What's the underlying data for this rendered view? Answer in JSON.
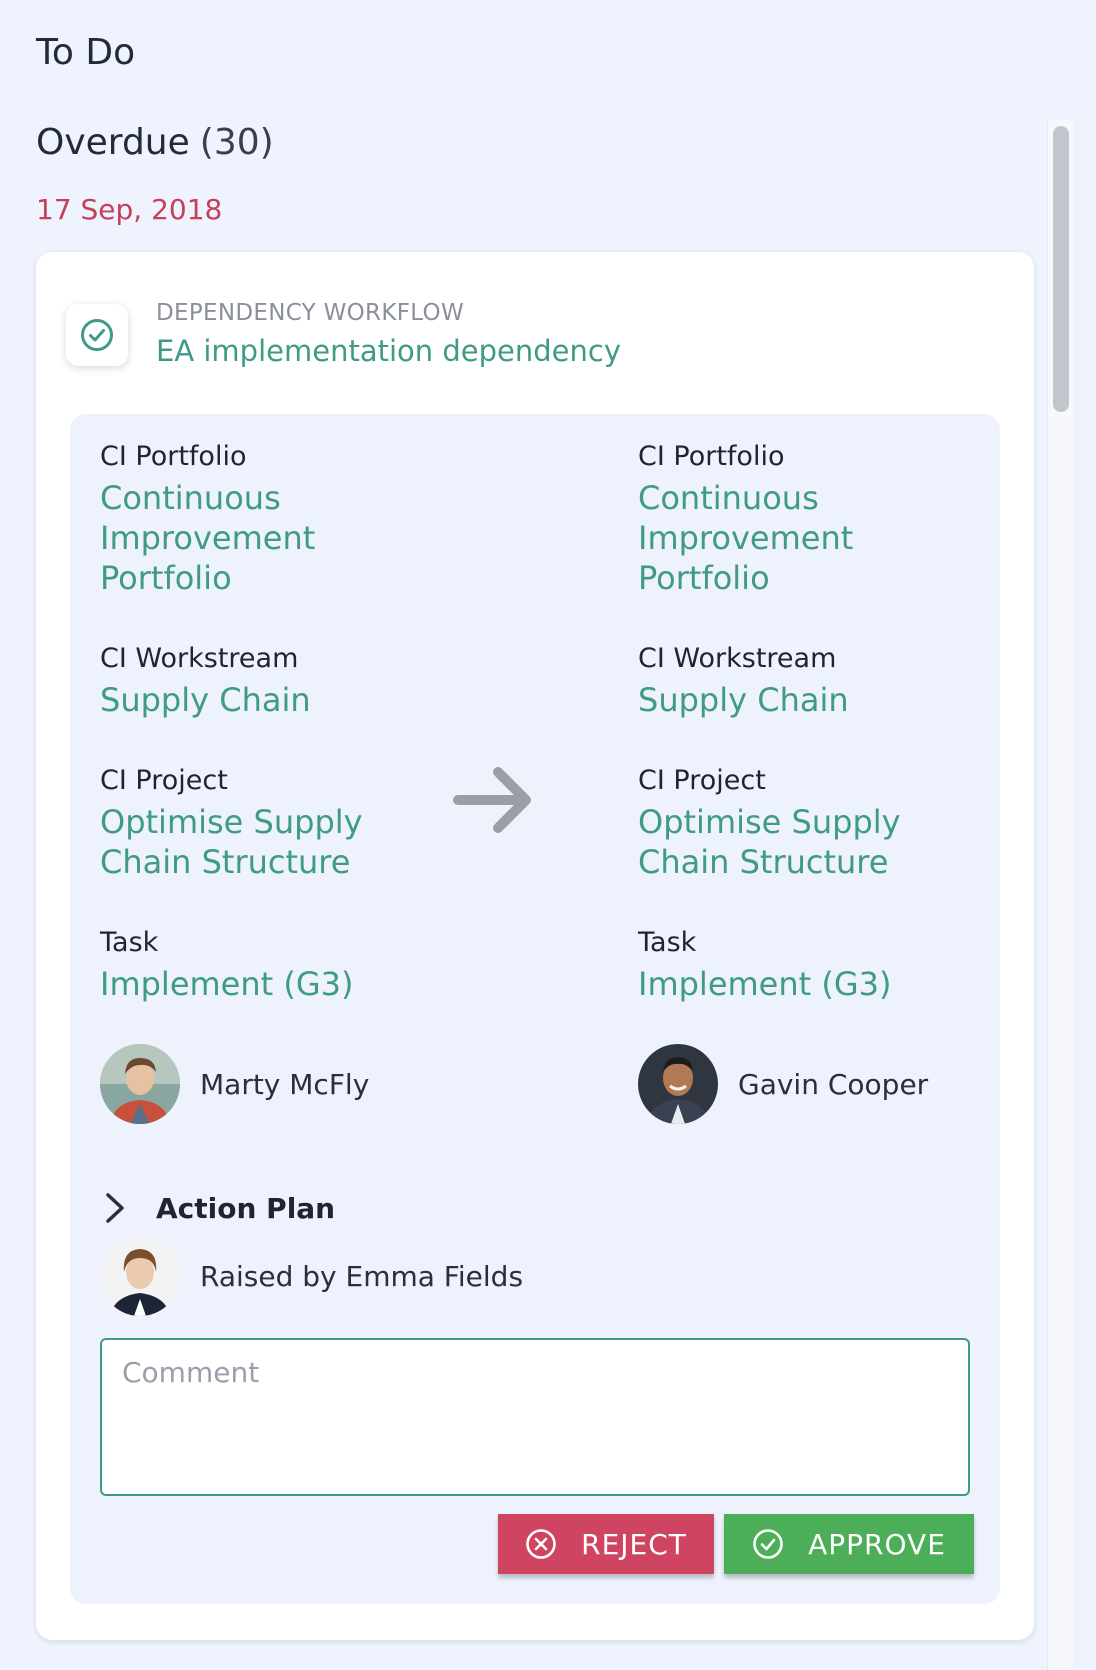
{
  "page": {
    "title": "To Do"
  },
  "section": {
    "heading": "Overdue",
    "count": "(30)",
    "date": "17 Sep, 2018"
  },
  "card": {
    "workflow_icon": "check-circle-icon",
    "workflow_type": "DEPENDENCY WORKFLOW",
    "workflow_name": "EA implementation dependency",
    "source": {
      "fields": [
        {
          "label": "CI Portfolio",
          "value": "Continuous\nImprovement\nPortfolio"
        },
        {
          "label": "CI Workstream",
          "value": "Supply Chain"
        },
        {
          "label": "CI Project",
          "value": "Optimise Supply\nChain Structure"
        },
        {
          "label": "Task",
          "value": "Implement (G3)"
        }
      ],
      "person": "Marty McFly"
    },
    "target": {
      "fields": [
        {
          "label": "CI Portfolio",
          "value": "Continuous\nImprovement\nPortfolio"
        },
        {
          "label": "CI Workstream",
          "value": "Supply Chain"
        },
        {
          "label": "CI Project",
          "value": "Optimise Supply\nChain Structure"
        },
        {
          "label": "Task",
          "value": "Implement (G3)"
        }
      ],
      "person": "Gavin Cooper"
    },
    "arrow_icon": "arrow-right-icon",
    "action_plan_label": "Action Plan",
    "raised_by": "Raised by Emma Fields",
    "comment_placeholder": "Comment",
    "reject_label": "REJECT",
    "approve_label": "APPROVE"
  },
  "colors": {
    "accent": "#3f9a86",
    "date": "#c7405b",
    "reject": "#cf4461",
    "approve": "#4cae58"
  }
}
